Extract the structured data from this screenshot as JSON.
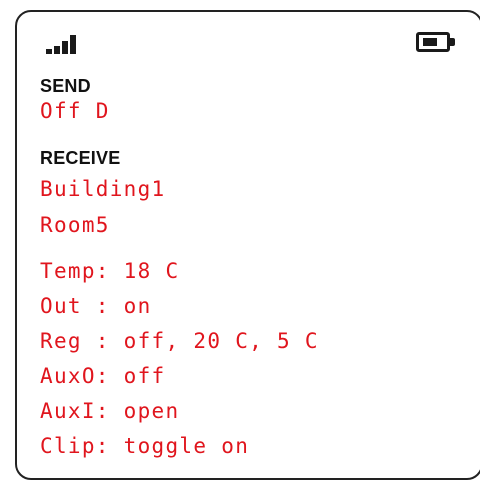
{
  "status": {
    "signal_icon": "signal-strength-icon",
    "battery_icon": "battery-icon"
  },
  "send": {
    "label": "SEND",
    "lines": [
      "Off D"
    ]
  },
  "receive": {
    "label": "RECEIVE",
    "lines": [
      "Building1",
      "Room5",
      "Temp: 18 C",
      "Out : on",
      "Reg : off, 20 C, 5 C",
      "AuxO: off",
      "AuxI: open",
      "Clip: toggle on"
    ]
  },
  "colors": {
    "display_text": "#e0151d",
    "label_text": "#111111"
  }
}
